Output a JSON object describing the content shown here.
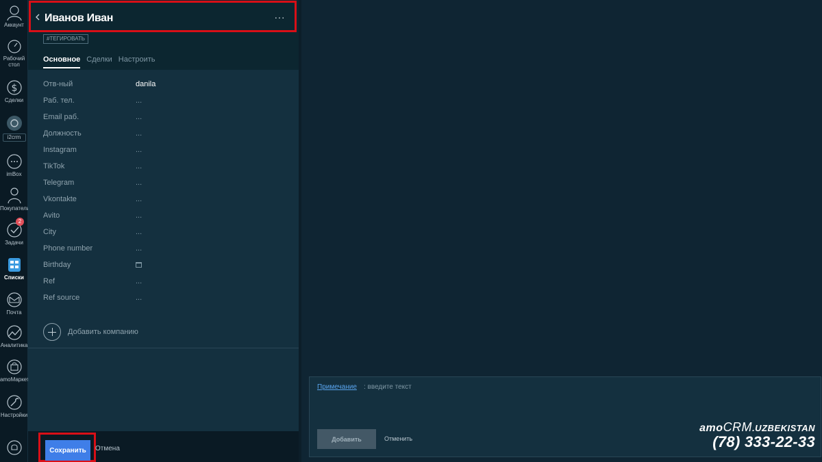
{
  "nav": {
    "account": "Аккаунт",
    "dashboard_line1": "Рабочий",
    "dashboard_line2": "стол",
    "deals": "Сделки",
    "i2crm": "i2crm",
    "imbox": "imBox",
    "buyers": "Покупатели",
    "tasks": "Задачи",
    "tasks_badge": "2",
    "lists": "Списки",
    "mail": "Почта",
    "analytics": "Аналитика",
    "market": "amoМаркет",
    "settings": "Настройки"
  },
  "card": {
    "title": "Иванов Иван",
    "more": "···",
    "tag": "#ТЕГИРОВАТЬ",
    "tabs": [
      "Основное",
      "Сделки",
      "Настроить"
    ],
    "fields": [
      {
        "label": "Отв-ный",
        "value": "danila"
      },
      {
        "label": "Раб. тел.",
        "value": "..."
      },
      {
        "label": "Email раб.",
        "value": "..."
      },
      {
        "label": "Должность",
        "value": "..."
      },
      {
        "label": "Instagram",
        "value": "..."
      },
      {
        "label": "TikTok",
        "value": "..."
      },
      {
        "label": "Telegram",
        "value": "..."
      },
      {
        "label": "Vkontakte",
        "value": "..."
      },
      {
        "label": "Avito",
        "value": "..."
      },
      {
        "label": "City",
        "value": "..."
      },
      {
        "label": "Phone number",
        "value": "..."
      },
      {
        "label": "Birthday",
        "value": ""
      },
      {
        "label": "Ref",
        "value": "..."
      },
      {
        "label": "Ref source",
        "value": "..."
      }
    ],
    "add_company": "Добавить компанию",
    "save": "Сохранить",
    "cancel": "Отмена"
  },
  "note": {
    "link": "Примечание",
    "placeholder": ": введите текст",
    "add": "Добавить",
    "cancel": "Отменить"
  },
  "watermark": {
    "brand_amo": "amo",
    "brand_crm": "CRM",
    "brand_uz": ".UZBEKISTAN",
    "phone": "(78) 333-22-33"
  },
  "colors": {
    "accent": "#3f7ee8",
    "highlight": "#d90f17",
    "badge": "#e2505a",
    "link": "#5aa6f0"
  }
}
